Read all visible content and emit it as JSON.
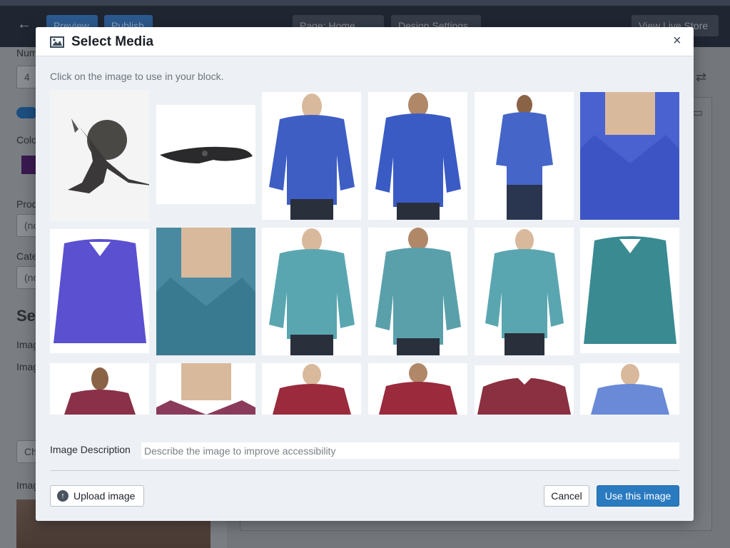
{
  "background": {
    "topbar": {
      "back": "←",
      "preview_label": "Preview",
      "publish_label": "Publish",
      "page_select": "Page: Home",
      "design_settings": "Design Settings",
      "view_live": "View Live Store"
    },
    "left_panel": {
      "num_label": "Num",
      "num_value": "4",
      "color_label": "Colo",
      "product_label": "Prod",
      "product_value": "(no",
      "category_label": "Cate",
      "category_value": "(no",
      "section_heading": "Se",
      "image_label_1": "Imag",
      "image_label_2": "Imag",
      "choose_label": "Ch",
      "image_label_3": "Imag"
    }
  },
  "modal": {
    "title": "Select Media",
    "close": "×",
    "instruction": "Click on the image to use in your block.",
    "images": [
      {
        "name": "warrior-woman-logo"
      },
      {
        "name": "folding-knife"
      },
      {
        "name": "blue-check-shirt-front"
      },
      {
        "name": "blue-check-shirt-back"
      },
      {
        "name": "blue-check-shirt-model-full"
      },
      {
        "name": "blue-check-shirt-collar-closeup"
      },
      {
        "name": "purple-check-shirt-folded"
      },
      {
        "name": "teal-check-shirt-collar-closeup"
      },
      {
        "name": "teal-check-shirt-front"
      },
      {
        "name": "teal-check-shirt-back"
      },
      {
        "name": "teal-check-shirt-front-2"
      },
      {
        "name": "teal-check-shirt-folded"
      },
      {
        "name": "red-check-shirt-model"
      },
      {
        "name": "red-check-shirt-collar-closeup"
      },
      {
        "name": "red-check-shirt-front"
      },
      {
        "name": "red-check-shirt-back"
      },
      {
        "name": "red-check-shirt-folded"
      },
      {
        "name": "lightblue-check-shirt-front"
      }
    ],
    "description_label": "Image Description",
    "description_placeholder": "Describe the image to improve accessibility",
    "upload_label": "Upload image",
    "cancel_label": "Cancel",
    "use_label": "Use this image"
  },
  "colors": {
    "primary_button": "#2a7ac0",
    "modal_background": "#edf1f5",
    "header_dark": "#1f2632"
  }
}
